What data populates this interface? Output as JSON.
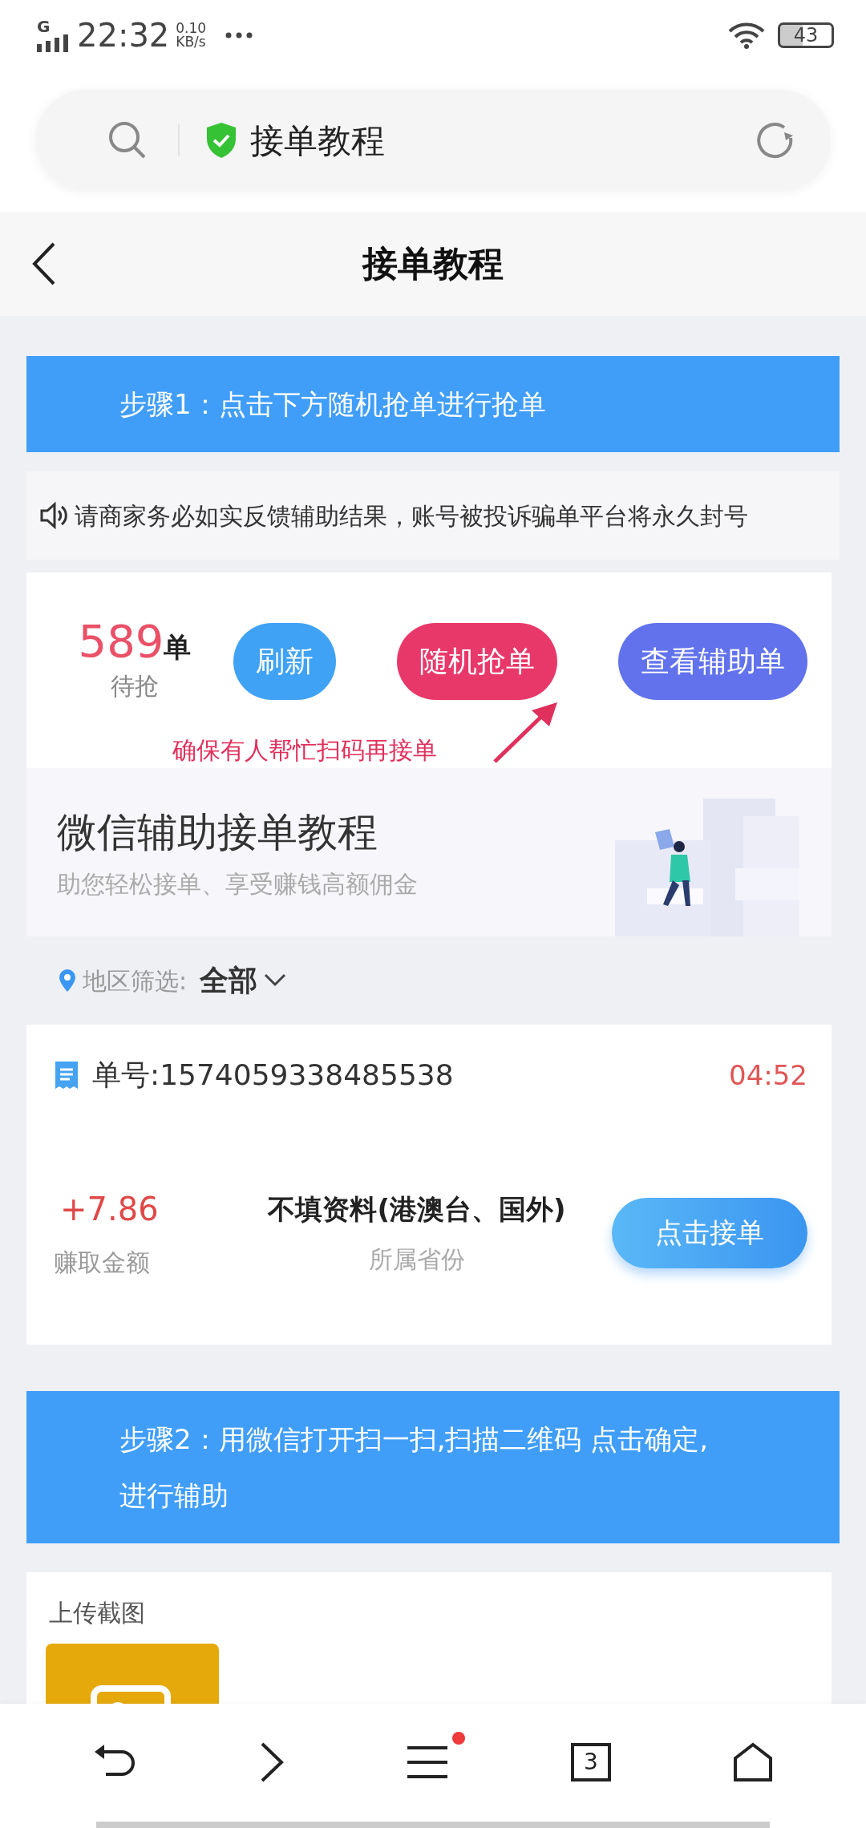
{
  "status_bar": {
    "network": "G",
    "time": "22:32",
    "speed": "0.10",
    "speed_unit": "KB/s",
    "battery": "43"
  },
  "address_bar": {
    "title": "接单教程"
  },
  "header": {
    "title": "接单教程"
  },
  "step1": {
    "text": "步骤1：点击下方随机抢单进行抢单"
  },
  "notice": {
    "text": "请商家务必如实反馈辅助结果，账号被投诉骗单平台将永久封号"
  },
  "stats": {
    "count": "589",
    "unit": "单",
    "label": "待抢"
  },
  "buttons": [
    {
      "label": "刷新",
      "color": "#3fa2f4"
    },
    {
      "label": "随机抢单",
      "color": "#e8386a"
    },
    {
      "label": "查看辅助单",
      "color": "#6172ec"
    }
  ],
  "annotation": {
    "text": "确保有人帮忙扫码再接单"
  },
  "banner": {
    "title": "微信辅助接单教程",
    "subtitle": "助您轻松接单、享受赚钱高额佣金"
  },
  "filter": {
    "label": "地区筛选:",
    "value": "全部"
  },
  "order": {
    "number": "单号:1574059338485538",
    "timer": "04:52",
    "amount": "+7.86",
    "amount_label": "赚取金额",
    "province": "不填资料(港澳台、国外)",
    "province_label": "所属省份",
    "button": "点击接单"
  },
  "step2": {
    "text": "步骤2：用微信打开扫一扫,扫描二维码 点击确定,进行辅助"
  },
  "upload": {
    "label": "上传截图"
  },
  "bottom_nav": {
    "tab_count": "3",
    "menu_dot": true
  }
}
